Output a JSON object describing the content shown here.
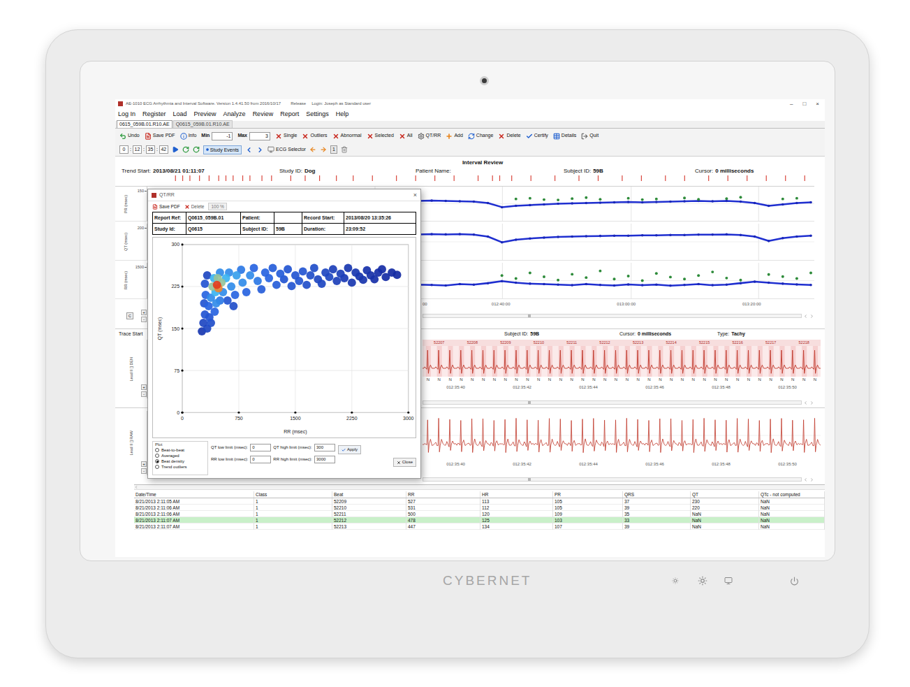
{
  "device": {
    "brand": "CYBERNET"
  },
  "window": {
    "title": "AE-1010 ECG Arrhythmia and Interval Software.  Version 1.4.41.50 from 2016/10/17",
    "release": "Release",
    "login": "Login: Joseph as Standard user",
    "controls": [
      "–",
      "□",
      "×"
    ]
  },
  "menu": [
    "Log In",
    "Register",
    "Load",
    "Preview",
    "Analyze",
    "Review",
    "Report",
    "Settings",
    "Help"
  ],
  "tabs": [
    {
      "label": "0615_059B.01.R10.AE",
      "selected": true
    },
    {
      "label": "Q0615_059B.01.R10.AE",
      "selected": false
    }
  ],
  "toolbar": [
    {
      "kind": "button",
      "label": "Undo"
    },
    {
      "kind": "button",
      "label": "Save PDF"
    },
    {
      "kind": "button",
      "label": "Info"
    },
    {
      "kind": "field",
      "label": "Min",
      "value": "-1"
    },
    {
      "kind": "field",
      "label": "Max",
      "value": "3"
    },
    {
      "kind": "button",
      "label": "Single"
    },
    {
      "kind": "button",
      "label": "Outliers"
    },
    {
      "kind": "button",
      "label": "Abnormal"
    },
    {
      "kind": "button",
      "label": "Selected"
    },
    {
      "kind": "button",
      "label": "All"
    },
    {
      "kind": "button",
      "label": "QT/RR"
    },
    {
      "kind": "button",
      "label": "Add"
    },
    {
      "kind": "button",
      "label": "Change"
    },
    {
      "kind": "button",
      "label": "Delete"
    },
    {
      "kind": "button",
      "label": "Certify"
    },
    {
      "kind": "button",
      "label": "Details"
    },
    {
      "kind": "button",
      "label": "Quit"
    }
  ],
  "navigator": {
    "time": [
      "0",
      "12",
      "35",
      "42"
    ],
    "separator": ":",
    "study_events": {
      "label": "Study Events",
      "on": true
    },
    "ecg_selector": "ECG Selector",
    "page": "1"
  },
  "interval_review": {
    "title": "Interval Review",
    "fields": [
      {
        "label": "Trend Start:",
        "value": "2013/08/21 01:11:07"
      },
      {
        "label": "Study ID:",
        "value": "Dog"
      },
      {
        "label": "Patient Name:",
        "value": ""
      },
      {
        "label": "Subject ID:",
        "value": "59B"
      },
      {
        "label": "Cursor:",
        "value": "0 milliseconds"
      }
    ],
    "event_marks": [
      60,
      75,
      90,
      110,
      130,
      150,
      165,
      180,
      200,
      215,
      240,
      260,
      300,
      330,
      360,
      395,
      430,
      470,
      520,
      560,
      600,
      640,
      690,
      720,
      735,
      760,
      800,
      850,
      900,
      940,
      990,
      1030,
      1080,
      1120,
      1170,
      1210,
      1250,
      1290,
      1330,
      1370
    ],
    "event_span": 1390,
    "charts": [
      {
        "label": "PR (msec)",
        "ticks": [
          "150"
        ],
        "min": 60,
        "max": 160,
        "values": [
          118,
          117,
          119,
          118,
          116,
          118,
          117,
          119,
          118,
          117,
          118,
          119,
          118,
          117,
          116,
          118,
          119,
          118,
          117,
          118,
          119,
          118,
          117,
          116,
          112,
          100,
          104,
          106,
          108,
          110,
          111,
          112,
          113,
          114,
          115,
          114,
          115,
          116,
          117,
          118,
          117,
          118,
          116,
          112,
          104,
          108,
          112,
          114
        ],
        "outliers": [
          [
            26,
            124
          ],
          [
            27,
            126
          ],
          [
            28,
            122
          ],
          [
            29,
            121
          ],
          [
            30,
            125
          ],
          [
            31,
            128
          ],
          [
            32,
            123
          ],
          [
            34,
            126
          ],
          [
            35,
            122
          ],
          [
            36,
            124
          ],
          [
            38,
            127
          ],
          [
            39,
            123
          ],
          [
            41,
            125
          ],
          [
            42,
            129
          ],
          [
            45,
            124
          ],
          [
            46,
            126
          ]
        ]
      },
      {
        "label": "QT (msec)",
        "ticks": [
          "200"
        ],
        "min": 140,
        "max": 255,
        "values": [
          222,
          221,
          222,
          223,
          222,
          221,
          222,
          222,
          221,
          222,
          223,
          222,
          221,
          222,
          222,
          221,
          222,
          223,
          222,
          221,
          222,
          221,
          222,
          220,
          214,
          196,
          204,
          208,
          211,
          213,
          214,
          215,
          216,
          217,
          217,
          218,
          218,
          219,
          219,
          220,
          220,
          221,
          219,
          214,
          200,
          209,
          214,
          217
        ],
        "outliers": []
      },
      {
        "label": "RR (msec)",
        "ticks": [
          "1500"
        ],
        "min": 0,
        "max": 1400,
        "values": [
          520,
          540,
          500,
          560,
          530,
          510,
          550,
          520,
          540,
          500,
          530,
          560,
          520,
          510,
          540,
          530,
          500,
          550,
          520,
          540,
          530,
          510,
          560,
          540,
          600,
          680,
          620,
          580,
          560,
          540,
          520,
          560,
          530,
          510,
          550,
          520,
          540,
          500,
          530,
          560,
          520,
          540,
          600,
          660,
          620,
          580,
          550,
          530
        ],
        "outliers": [
          [
            25,
            900
          ],
          [
            26,
            780
          ],
          [
            27,
            1000
          ],
          [
            28,
            850
          ],
          [
            29,
            720
          ],
          [
            30,
            950
          ],
          [
            31,
            820
          ],
          [
            32,
            1080
          ],
          [
            33,
            760
          ],
          [
            34,
            880
          ],
          [
            35,
            700
          ],
          [
            36,
            980
          ],
          [
            37,
            840
          ],
          [
            38,
            760
          ],
          [
            39,
            900
          ],
          [
            40,
            1040
          ],
          [
            41,
            800
          ],
          [
            42,
            720
          ],
          [
            44,
            940
          ],
          [
            45,
            860
          ],
          [
            46,
            780
          ],
          [
            47,
            1000
          ]
        ]
      }
    ],
    "x_ticks": [
      "00",
      "012:40:00",
      "013:00:00",
      "013:20:00"
    ],
    "zoom": {
      "reset": "C",
      "in": "+",
      "out": "-"
    }
  },
  "trace": {
    "title": "Trace Start",
    "fields": [
      {
        "label": "Subject ID:",
        "value": "59B"
      },
      {
        "label": "Cursor:",
        "value": "0 milliseconds"
      },
      {
        "label": "Type:",
        "value": "Tachy"
      }
    ],
    "lead": "Lead II [] DEN",
    "beat_numbers": [
      "52207",
      "52208",
      "52209",
      "52210",
      "52211",
      "52212",
      "52213",
      "52214",
      "52215",
      "52216",
      "52217",
      "52218"
    ],
    "beat_labels": [
      "N",
      "N",
      "N",
      "N",
      "N",
      "N",
      "N",
      "N",
      "N",
      "N",
      "N",
      "N",
      "N",
      "N",
      "N",
      "N",
      "N",
      "N",
      "N",
      "N",
      "N",
      "N",
      "N",
      "N",
      "N",
      "N",
      "N",
      "N",
      "N",
      "N",
      "N",
      "N",
      "N",
      "N",
      "N",
      "N"
    ],
    "x_ticks": [
      "012:35:40",
      "012:35:42",
      "012:35:44",
      "012:35:46",
      "012:35:48",
      "012:35:50"
    ],
    "zoom": {
      "in": "+",
      "out": "-"
    }
  },
  "raw_trace": {
    "lead": "Lead II [] RAW",
    "x_ticks": [
      "012:35:40",
      "012:35:42",
      "012:35:44",
      "012:35:46",
      "012:35:48",
      "012:35:50"
    ],
    "zoom": {
      "in": "+",
      "out": "-"
    }
  },
  "beat_table": {
    "columns": [
      "Date/Time",
      "Class",
      "Beat",
      "RR",
      "HR",
      "PR",
      "QRS",
      "QT",
      "QTc - not computed"
    ],
    "rows": [
      {
        "cells": [
          "8/21/2013 2:11:05 AM",
          "1",
          "52209",
          "527",
          "113",
          "105",
          "37",
          "230",
          "NaN"
        ],
        "selected": false
      },
      {
        "cells": [
          "8/21/2013 2:11:06 AM",
          "1",
          "52210",
          "531",
          "112",
          "105",
          "39",
          "220",
          "NaN"
        ],
        "selected": false
      },
      {
        "cells": [
          "8/21/2013 2:11:06 AM",
          "1",
          "52211",
          "500",
          "120",
          "109",
          "35",
          "NaN",
          "NaN"
        ],
        "selected": false
      },
      {
        "cells": [
          "8/21/2013 2:11:07 AM",
          "1",
          "52212",
          "478",
          "125",
          "103",
          "33",
          "NaN",
          "NaN"
        ],
        "selected": true
      },
      {
        "cells": [
          "8/21/2013 2:11:07 AM",
          "1",
          "52213",
          "447",
          "134",
          "107",
          "39",
          "NaN",
          "NaN"
        ],
        "selected": false
      }
    ]
  },
  "dialog": {
    "title": "QT/RR",
    "close": "×",
    "toolbar": {
      "save": "Save PDF",
      "delete": "Delete",
      "zoom": "100 %"
    },
    "info": [
      [
        {
          "label": "Report Ref:",
          "value": "Q0615_059B.01"
        },
        {
          "label": "Patient:",
          "value": ""
        },
        {
          "label": "Record Start:",
          "value": "2013/08/20 13:35:26"
        }
      ],
      [
        {
          "label": "Study Id:",
          "value": "Q0615"
        },
        {
          "label": "Subject ID:",
          "value": "59B"
        },
        {
          "label": "Duration:",
          "value": "23:09:52"
        }
      ]
    ],
    "chart": {
      "x_label": "RR (msec)",
      "y_label": "QT (msec)",
      "x_ticks": [
        "0",
        "750",
        "1500",
        "2250",
        "3000"
      ],
      "y_ticks": [
        "0",
        "75",
        "150",
        "225",
        "300"
      ],
      "x_max": 3000,
      "y_max": 300,
      "points": [
        [
          260,
          145,
          0.1
        ],
        [
          280,
          160,
          0.2
        ],
        [
          300,
          175,
          0.3
        ],
        [
          290,
          195,
          0.3
        ],
        [
          310,
          210,
          0.4
        ],
        [
          300,
          230,
          0.3
        ],
        [
          330,
          245,
          0.2
        ],
        [
          350,
          190,
          0.4
        ],
        [
          360,
          170,
          0.3
        ],
        [
          380,
          205,
          0.5
        ],
        [
          400,
          225,
          0.7
        ],
        [
          420,
          240,
          0.6
        ],
        [
          440,
          215,
          0.6
        ],
        [
          460,
          228,
          1.0
        ],
        [
          480,
          222,
          0.9
        ],
        [
          470,
          240,
          0.7
        ],
        [
          500,
          250,
          0.5
        ],
        [
          520,
          232,
          0.7
        ],
        [
          540,
          215,
          0.5
        ],
        [
          430,
          180,
          0.4
        ],
        [
          330,
          150,
          0.2
        ],
        [
          380,
          160,
          0.25
        ],
        [
          450,
          195,
          0.5
        ],
        [
          500,
          200,
          0.45
        ],
        [
          580,
          240,
          0.6
        ],
        [
          620,
          250,
          0.5
        ],
        [
          650,
          225,
          0.5
        ],
        [
          700,
          210,
          0.4
        ],
        [
          720,
          245,
          0.55
        ],
        [
          780,
          255,
          0.45
        ],
        [
          800,
          232,
          0.5
        ],
        [
          850,
          215,
          0.4
        ],
        [
          900,
          245,
          0.5
        ],
        [
          950,
          258,
          0.4
        ],
        [
          1000,
          235,
          0.45
        ],
        [
          1050,
          220,
          0.35
        ],
        [
          1100,
          250,
          0.4
        ],
        [
          1150,
          240,
          0.4
        ],
        [
          1200,
          258,
          0.35
        ],
        [
          1250,
          228,
          0.35
        ],
        [
          1300,
          248,
          0.35
        ],
        [
          1350,
          238,
          0.3
        ],
        [
          1400,
          256,
          0.3
        ],
        [
          1450,
          226,
          0.3
        ],
        [
          1500,
          245,
          0.3
        ],
        [
          600,
          200,
          0.3
        ],
        [
          680,
          190,
          0.25
        ],
        [
          1550,
          235,
          0.3
        ],
        [
          1600,
          252,
          0.3
        ],
        [
          1650,
          228,
          0.25
        ],
        [
          1700,
          245,
          0.25
        ],
        [
          1750,
          258,
          0.25
        ],
        [
          1800,
          238,
          0.2
        ],
        [
          1850,
          230,
          0.2
        ],
        [
          1900,
          250,
          0.2
        ],
        [
          1950,
          242,
          0.2
        ],
        [
          2000,
          256,
          0.15
        ],
        [
          2050,
          235,
          0.15
        ],
        [
          2100,
          248,
          0.15
        ],
        [
          2150,
          240,
          0.12
        ],
        [
          2200,
          258,
          0.1
        ],
        [
          2250,
          232,
          0.1
        ],
        [
          2300,
          250,
          0.1
        ],
        [
          2350,
          243,
          0.08
        ],
        [
          2400,
          237,
          0.08
        ],
        [
          2450,
          254,
          0.06
        ],
        [
          2500,
          245,
          0.05
        ],
        [
          2550,
          238,
          0.05
        ],
        [
          2600,
          250,
          0.04
        ],
        [
          2650,
          256,
          0.03
        ],
        [
          2700,
          242,
          0.03
        ],
        [
          2780,
          250,
          0.02
        ],
        [
          2850,
          246,
          0.02
        ]
      ]
    },
    "plot": {
      "legend": "Plot",
      "options": [
        {
          "label": "Beat-to-beat",
          "selected": false
        },
        {
          "label": "Averaged",
          "selected": false
        },
        {
          "label": "Beat density",
          "selected": true
        },
        {
          "label": "Trend outliers",
          "selected": false
        }
      ]
    },
    "limits": [
      {
        "label": "QT low limit (msec):",
        "value": "0"
      },
      {
        "label": "QT high limit (msec):",
        "value": "300"
      },
      {
        "label": "RR low limit (msec):",
        "value": "0"
      },
      {
        "label": "RR high limit (msec):",
        "value": "3000"
      }
    ],
    "apply": "Apply",
    "close_button": "Close"
  }
}
